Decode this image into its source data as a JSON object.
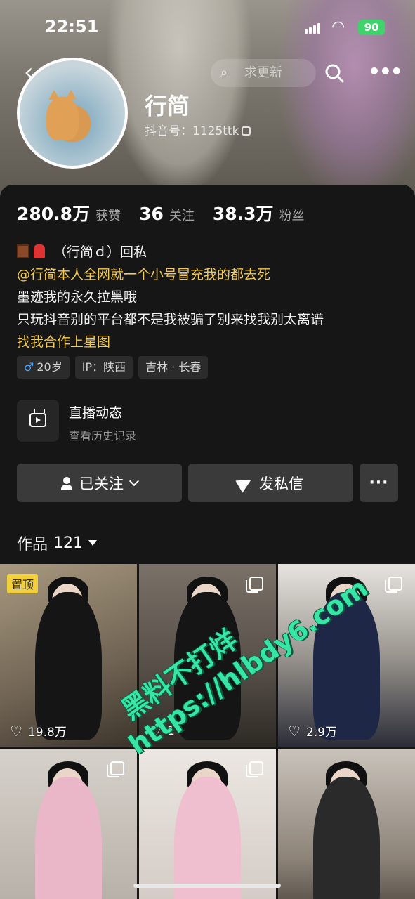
{
  "status_bar": {
    "time": "22:51",
    "battery": "90"
  },
  "header": {
    "search_placeholder": "求更新",
    "back_glyph": "‹",
    "more_glyph": "•••"
  },
  "profile": {
    "name": "行简",
    "douyin_id": "抖音号：1125ttk",
    "stats": [
      {
        "num": "280.8万",
        "label": "获赞"
      },
      {
        "num": "36",
        "label": "关注"
      },
      {
        "num": "38.3万",
        "label": "粉丝"
      }
    ],
    "bio": {
      "line1": "（行简ｄ）回私",
      "line2": "@行简本人全网就一个小号冒充我的都去死",
      "line3": "墨迹我的永久拉黑哦",
      "line4": "只玩抖音别的平台都不是我被骗了别来找我别太离谱",
      "line5": "找我合作上星图"
    },
    "tags": {
      "age": "20岁",
      "ip": "IP：陕西",
      "location": "吉林 · 长春"
    }
  },
  "live": {
    "title": "直播动态",
    "subtitle": "查看历史记录"
  },
  "actions": {
    "follow": "已关注",
    "message": "发私信",
    "more": "···"
  },
  "works": {
    "label": "作品",
    "count": "121",
    "items": [
      {
        "pinned": "置顶",
        "likes": "19.8万",
        "color": "#8c7d6b"
      },
      {
        "likes": "1",
        "color": "#6a625a"
      },
      {
        "likes": "2.9万",
        "color": "#3a3d4a"
      },
      {
        "likes": "",
        "color": "#b9b3ac"
      },
      {
        "likes": "",
        "color": "#d8d2cb"
      },
      {
        "likes": "",
        "color": "#a49a8f"
      }
    ]
  },
  "watermark": {
    "line1": "黑料不打烊",
    "line2": "https://hlbdy6.com"
  }
}
